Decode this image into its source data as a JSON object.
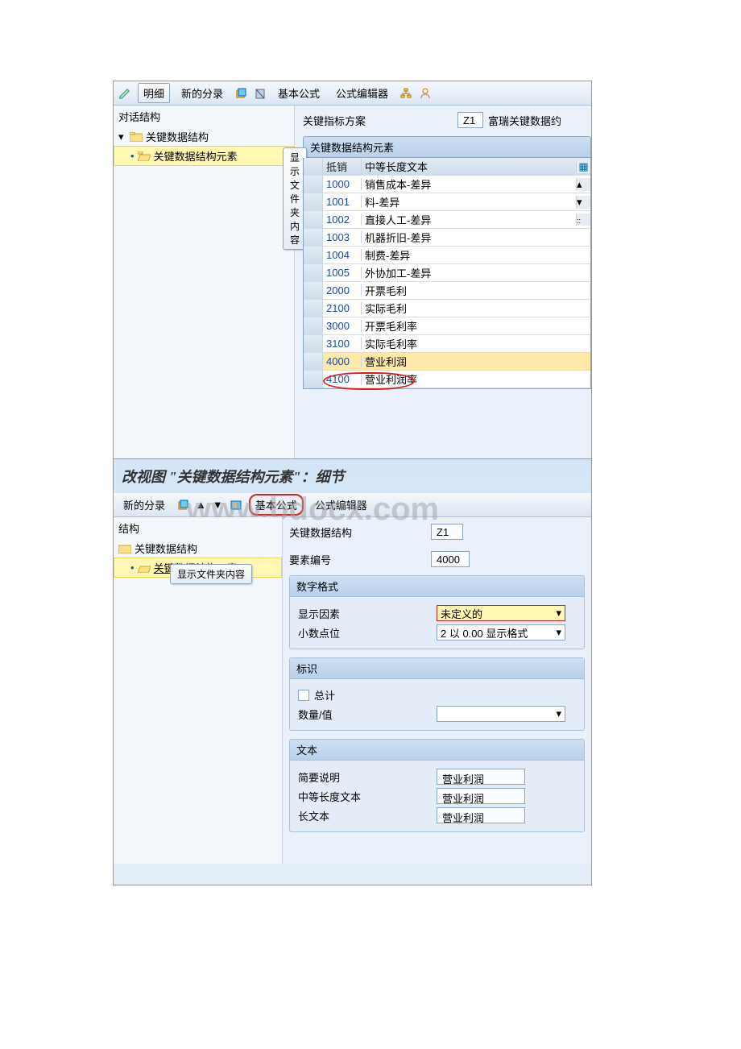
{
  "toolbar1": {
    "detail": "明细",
    "new_entry": "新的分录",
    "basic_formula": "基本公式",
    "formula_editor": "公式编辑器"
  },
  "tree1": {
    "title": "对话结构",
    "node1": "关键数据结构",
    "node2": "关键数据结构元素",
    "tooltip": "显示文件夹内容"
  },
  "right1": {
    "scheme_label": "关键指标方案",
    "scheme_value": "Z1",
    "scheme_text": "富瑞关键数据约",
    "section": "关键数据结构元素",
    "col_code": "抵销",
    "col_text": "中等长度文本",
    "rows": [
      {
        "code": "1000",
        "text": "销售成本-差异"
      },
      {
        "code": "1001",
        "text": "料-差异"
      },
      {
        "code": "1002",
        "text": "直接人工-差异"
      },
      {
        "code": "1003",
        "text": "机器折旧-差异"
      },
      {
        "code": "1004",
        "text": "制费-差异"
      },
      {
        "code": "1005",
        "text": "外协加工-差异"
      },
      {
        "code": "2000",
        "text": "开票毛利"
      },
      {
        "code": "2100",
        "text": "实际毛利"
      },
      {
        "code": "3000",
        "text": "开票毛利率"
      },
      {
        "code": "3100",
        "text": "实际毛利率"
      },
      {
        "code": "4000",
        "text": "营业利润"
      },
      {
        "code": "4100",
        "text": "营业利润率"
      }
    ]
  },
  "title2": "改视图 \"关键数据结构元素\"：细节",
  "toolbar2": {
    "new_entry": "新的分录",
    "basic_formula": "基本公式",
    "formula_editor": "公式编辑器"
  },
  "tree2": {
    "title": "结构",
    "node1": "关键数据结构",
    "node2": "关键数据结构元素",
    "tooltip": "显示文件夹内容"
  },
  "right2": {
    "struct_label": "关键数据结构",
    "struct_value": "Z1",
    "elem_label": "要素编号",
    "elem_value": "4000",
    "grp_numfmt": "数字格式",
    "disp_factor_label": "显示因素",
    "disp_factor_value": "未定义的",
    "decimals_label": "小数点位",
    "decimals_value": "2 以 0.00 显示格式",
    "grp_flag": "标识",
    "total_label": "总计",
    "qty_label": "数量/值",
    "grp_text": "文本",
    "short_label": "简要说明",
    "short_value": "营业利润",
    "medium_label": "中等长度文本",
    "medium_value": "营业利润",
    "long_label": "长文本",
    "long_value": "营业利润"
  },
  "watermark": "www.bdocx.com"
}
